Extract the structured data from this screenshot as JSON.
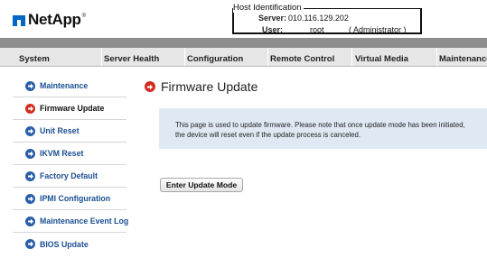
{
  "brand": {
    "logo_text": "NetApp",
    "trademark": "®"
  },
  "host": {
    "title": "Host Identification",
    "server_label": "Server:",
    "server_value": "010.116.129.202",
    "user_label": "User:",
    "user_value": "root",
    "user_role": "( Administrator )"
  },
  "nav": {
    "tabs": [
      {
        "label": "System"
      },
      {
        "label": "Server Health"
      },
      {
        "label": "Configuration"
      },
      {
        "label": "Remote Control"
      },
      {
        "label": "Virtual Media"
      },
      {
        "label": "Maintenance"
      }
    ]
  },
  "sidebar": {
    "items": [
      {
        "label": "Maintenance",
        "active": false
      },
      {
        "label": "Firmware Update",
        "active": true
      },
      {
        "label": "Unit Reset",
        "active": false
      },
      {
        "label": "IKVM Reset",
        "active": false
      },
      {
        "label": "Factory Default",
        "active": false
      },
      {
        "label": "IPMI Configuration",
        "active": false
      },
      {
        "label": "Maintenance Event Log",
        "active": false
      },
      {
        "label": "BIOS Update",
        "active": false
      }
    ]
  },
  "main": {
    "title": "Firmware Update",
    "info_line1": "This page is used to update firmware. Please note that once update mode has been initiated,",
    "info_line2": "the device will reset even if the update process is canceled.",
    "button_label": "Enter Update Mode"
  },
  "colors": {
    "link_blue": "#1b4f93",
    "icon_blue": "#2a5ea8",
    "icon_red": "#d52b1e",
    "info_bg": "#dfe9f4",
    "nav_bg": "#e6e6e6"
  }
}
